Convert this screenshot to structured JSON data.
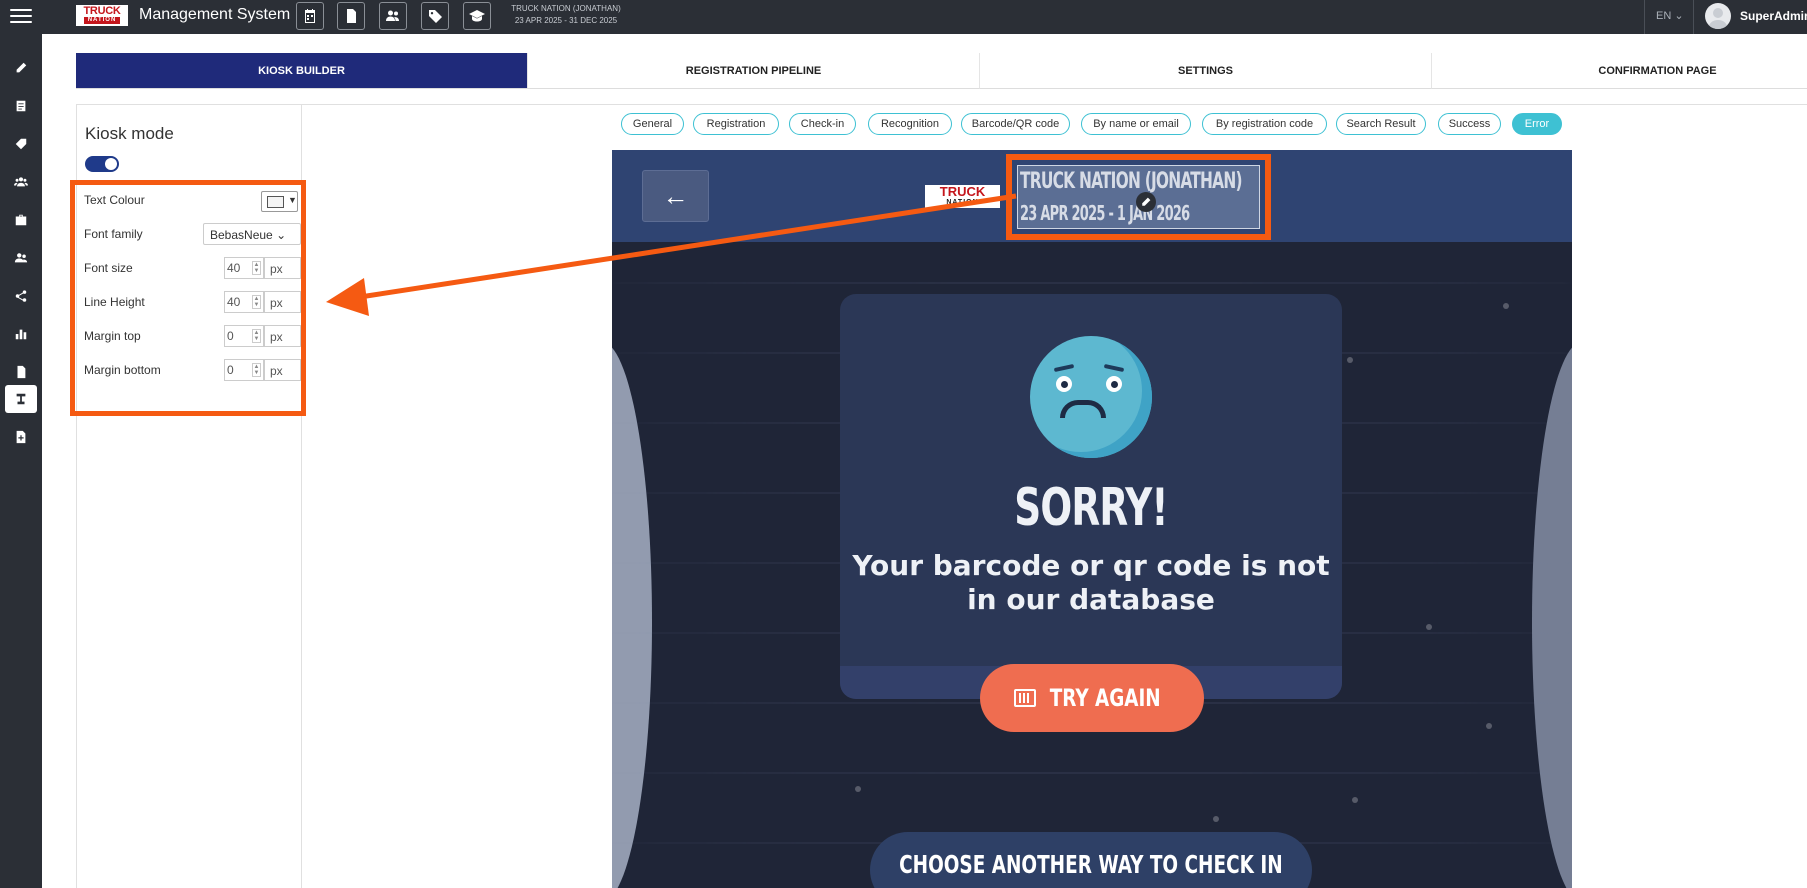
{
  "app": {
    "title": "Management System",
    "logo_line1": "TRUCK",
    "logo_line2": "NATION",
    "event_name": "TRUCK NATION (JONATHAN)",
    "event_dates": "23 APR 2025 - 31 DEC 2025",
    "language": "EN",
    "user": "SuperAdmin"
  },
  "toolbar_icons": [
    "calendar-icon",
    "document-icon",
    "people-icon",
    "tag-icon",
    "graduation-cap-icon"
  ],
  "sidebar_icons": [
    "pencil-icon",
    "form-icon",
    "tag-icon",
    "group-icon",
    "briefcase-icon",
    "user-icon",
    "share-icon",
    "bar-chart-icon",
    "document-icon",
    "kiosk-icon",
    "file-add-icon"
  ],
  "tabs": [
    {
      "label": "KIOSK BUILDER",
      "active": true
    },
    {
      "label": "REGISTRATION PIPELINE",
      "active": false
    },
    {
      "label": "SETTINGS",
      "active": false
    },
    {
      "label": "CONFIRMATION PAGE",
      "active": false
    }
  ],
  "panel": {
    "title": "Kiosk mode",
    "toggle_on": true,
    "text_colour_label": "Text Colour",
    "font_family_label": "Font family",
    "font_family_value": "BebasNeue",
    "font_size_label": "Font size",
    "font_size_value": "40",
    "line_height_label": "Line Height",
    "line_height_value": "40",
    "margin_top_label": "Margin top",
    "margin_top_value": "0",
    "margin_bottom_label": "Margin bottom",
    "margin_bottom_value": "0",
    "unit": "px"
  },
  "screens": [
    {
      "label": "General",
      "active": false
    },
    {
      "label": "Registration",
      "active": false
    },
    {
      "label": "Check-in",
      "active": false
    },
    {
      "label": "Recognition",
      "active": false
    },
    {
      "label": "Barcode/QR code",
      "active": false
    },
    {
      "label": "By name or email",
      "active": false
    },
    {
      "label": "By registration code",
      "active": false
    },
    {
      "label": "Search Result",
      "active": false
    },
    {
      "label": "Success",
      "active": false
    },
    {
      "label": "Error",
      "active": true
    }
  ],
  "kiosk": {
    "back_arrow": "←",
    "logo_line1": "TRUCK",
    "logo_line2": "NATION",
    "title_line1": "TRUCK NATION (JONATHAN)",
    "title_line2": "23 APR 2025 - 1 JAN 2026",
    "sorry": "SORRY!",
    "message": "Your barcode or qr code is not in our database",
    "try_again": "TRY AGAIN",
    "choose_another": "CHOOSE ANOTHER WAY TO CHECK IN"
  },
  "colors": {
    "accent_orange": "#f55a12",
    "active_tab": "#1f2a7a",
    "chip_border": "#3ec1d3",
    "kiosk_header": "#2f4472",
    "try_button": "#ef6d50"
  }
}
